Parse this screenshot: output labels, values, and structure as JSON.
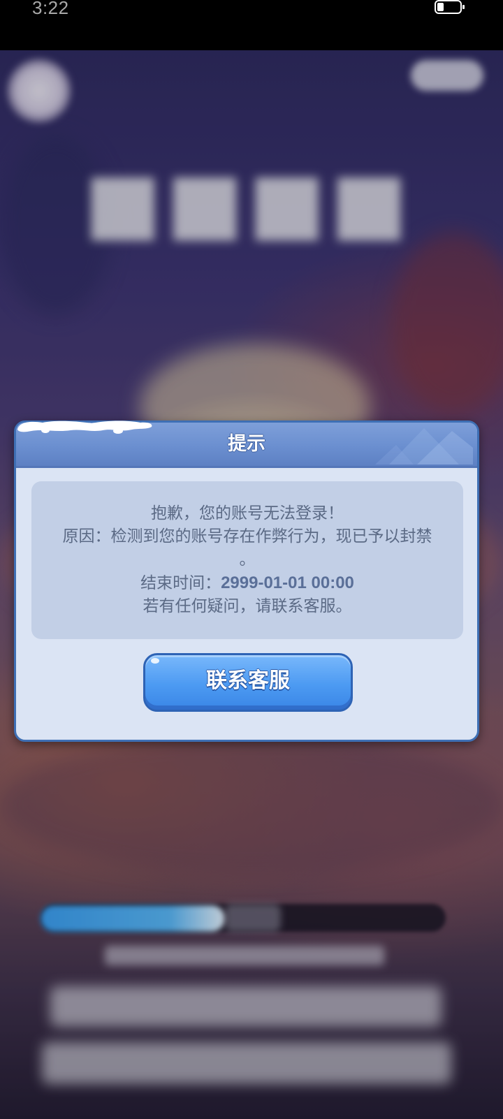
{
  "status_bar": {
    "time": "3:22",
    "battery_icon": "battery-icon"
  },
  "dialog": {
    "title": "提示",
    "message": {
      "line1": "抱歉，您的账号无法登录！",
      "line2_main": "原因：检测到您的账号存在作弊行为，现已予以封禁",
      "line2_tail": "。",
      "end_time_label": "结束时间：",
      "end_time_value": "2999-01-01 00:00",
      "line4": "若有任何疑问，请联系客服。"
    },
    "contact_button_label": "联系客服"
  },
  "colors": {
    "dialog_background": "#dbe4f4",
    "dialog_border": "#3e6fb4",
    "header_background": "#6b8fd0",
    "message_box_background": "#c2cfe6",
    "message_text": "#5b6a85",
    "button_background": "#4c9af2"
  }
}
